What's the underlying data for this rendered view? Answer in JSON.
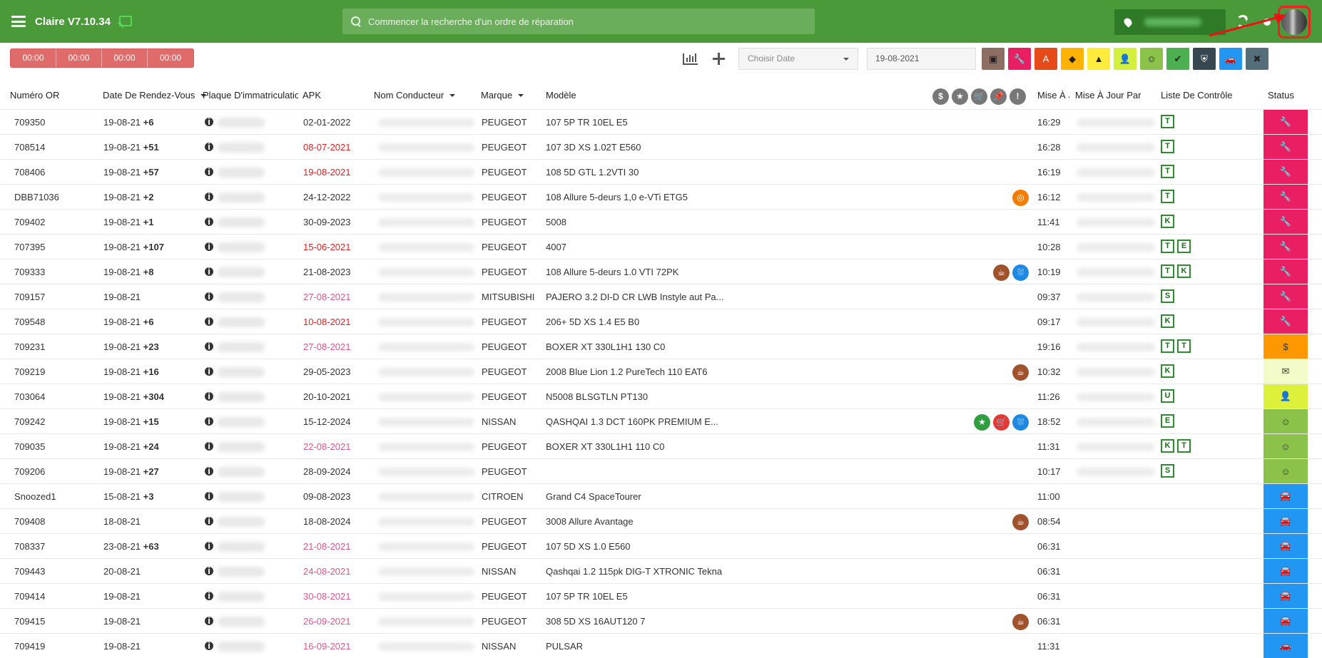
{
  "topbar": {
    "title": "Claire V7.10.34",
    "search_placeholder": "Commencer la recherche d'un ordre de réparation"
  },
  "toolbar": {
    "timers": [
      "00:00",
      "00:00",
      "00:00",
      "00:00"
    ],
    "date_select": "Choisir Date",
    "date_value": "19-08-2021",
    "filters": [
      {
        "name": "calendar-filter-button",
        "icon": "▣",
        "bg": "#8d6e63",
        "fg": "#222"
      },
      {
        "name": "wrench-filter-button",
        "icon": "🔧",
        "bg": "#e91e63",
        "fg": "#222"
      },
      {
        "name": "letter-a-filter-button",
        "icon": "A",
        "bg": "#e64a19",
        "fg": "#fff"
      },
      {
        "name": "tag-filter-button",
        "icon": "◆",
        "bg": "#ffb300",
        "fg": "#222"
      },
      {
        "name": "warning-filter-button",
        "icon": "▲",
        "bg": "#ffeb3b",
        "fg": "#222"
      },
      {
        "name": "user-check-filter-button",
        "icon": "👤",
        "bg": "#d4ef3c",
        "fg": "#222"
      },
      {
        "name": "smiley-filter-button",
        "icon": "☺",
        "bg": "#8bc34a",
        "fg": "#222"
      },
      {
        "name": "double-check-filter-button",
        "icon": "✔",
        "bg": "#4caf50",
        "fg": "#222"
      },
      {
        "name": "shield-filter-button",
        "icon": "⛨",
        "bg": "#37474f",
        "fg": "#fff"
      },
      {
        "name": "car-filter-button",
        "icon": "🚗",
        "bg": "#2196f3",
        "fg": "#222"
      },
      {
        "name": "cancel-filter-button",
        "icon": "✖",
        "bg": "#546e7a",
        "fg": "#222"
      }
    ]
  },
  "table": {
    "headers": {
      "or": "Numéro OR",
      "date": "Date De Rendez-Vous",
      "plate": "Plaque D'immatriculation",
      "apk": "APK",
      "driver": "Nom Conducteur",
      "brand": "Marque",
      "model": "Modèle",
      "updated": "Mise À Jour",
      "updated_by": "Mise À Jour Par",
      "checklist": "Liste De Contrôle",
      "status": "Status"
    },
    "header_icons": [
      "$",
      "★",
      "🛒",
      "📌",
      "!"
    ],
    "rows": [
      {
        "or": "709350",
        "date": "19-08-21",
        "delta": "+6",
        "apk": "02-01-2022",
        "apk_color": "",
        "brand": "PEUGEOT",
        "model": "107 5P TR 10EL E5",
        "time": "16:29",
        "checks": [
          "T"
        ],
        "status_icon": "🔧",
        "status_bg": "#e91e63",
        "icons": []
      },
      {
        "or": "708514",
        "date": "19-08-21",
        "delta": "+51",
        "apk": "08-07-2021",
        "apk_color": "red",
        "brand": "PEUGEOT",
        "model": "107 3D XS 1.02T E560",
        "time": "16:28",
        "checks": [
          "T"
        ],
        "status_icon": "🔧",
        "status_bg": "#e91e63",
        "icons": []
      },
      {
        "or": "708406",
        "date": "19-08-21",
        "delta": "+57",
        "apk": "19-08-2021",
        "apk_color": "red",
        "brand": "PEUGEOT",
        "model": "108 5D GTL 1.2VTI 30",
        "time": "16:19",
        "checks": [
          "T"
        ],
        "status_icon": "🔧",
        "status_bg": "#e91e63",
        "icons": []
      },
      {
        "or": "DBB71036",
        "date": "19-08-21",
        "delta": "+2",
        "apk": "24-12-2022",
        "apk_color": "",
        "brand": "PEUGEOT",
        "model": "108 Allure 5-deurs 1,0 e-VTi ETG5",
        "time": "16:12",
        "checks": [
          "T"
        ],
        "status_icon": "🔧",
        "status_bg": "#e91e63",
        "icons": [
          {
            "name": "target-icon",
            "g": "◎",
            "bg": "#f57c00"
          }
        ]
      },
      {
        "or": "709402",
        "date": "19-08-21",
        "delta": "+1",
        "apk": "30-09-2023",
        "apk_color": "",
        "brand": "PEUGEOT",
        "model": "5008",
        "time": "11:41",
        "checks": [
          "K"
        ],
        "status_icon": "🔧",
        "status_bg": "#e91e63",
        "icons": []
      },
      {
        "or": "707395",
        "date": "19-08-21",
        "delta": "+107",
        "apk": "15-06-2021",
        "apk_color": "red",
        "brand": "PEUGEOT",
        "model": "4007",
        "time": "10:28",
        "checks": [
          "T",
          "E"
        ],
        "status_icon": "🔧",
        "status_bg": "#e91e63",
        "icons": []
      },
      {
        "or": "709333",
        "date": "19-08-21",
        "delta": "+8",
        "apk": "21-08-2023",
        "apk_color": "",
        "brand": "PEUGEOT",
        "model": "108 Allure 5-deurs 1.0 VTI 72PK",
        "time": "10:19",
        "checks": [
          "T",
          "K"
        ],
        "status_icon": "🔧",
        "status_bg": "#e91e63",
        "icons": [
          {
            "name": "coffee-icon",
            "g": "☕",
            "bg": "#a0522d"
          },
          {
            "name": "car-wash-icon",
            "g": "⛆",
            "bg": "#1e88e5"
          }
        ]
      },
      {
        "or": "709157",
        "date": "19-08-21",
        "delta": "",
        "apk": "27-08-2021",
        "apk_color": "pink",
        "brand": "MITSUBISHI",
        "model": "PAJERO 3.2 DI-D CR LWB Instyle aut Pa...",
        "time": "09:37",
        "checks": [
          "S"
        ],
        "status_icon": "🔧",
        "status_bg": "#e91e63",
        "icons": []
      },
      {
        "or": "709548",
        "date": "19-08-21",
        "delta": "+6",
        "apk": "10-08-2021",
        "apk_color": "red",
        "brand": "PEUGEOT",
        "model": "206+ 5D XS 1.4 E5 B0",
        "time": "09:17",
        "checks": [
          "K"
        ],
        "status_icon": "🔧",
        "status_bg": "#e91e63",
        "icons": []
      },
      {
        "or": "709231",
        "date": "19-08-21",
        "delta": "+23",
        "apk": "27-08-2021",
        "apk_color": "pink",
        "brand": "PEUGEOT",
        "model": "BOXER XT 330L1H1 130 C0",
        "time": "19:16",
        "checks": [
          "T",
          "T"
        ],
        "status_icon": "$",
        "status_bg": "#ff9800",
        "icons": []
      },
      {
        "or": "709219",
        "date": "19-08-21",
        "delta": "+16",
        "apk": "29-05-2023",
        "apk_color": "",
        "brand": "PEUGEOT",
        "model": "2008 Blue Lion 1.2 PureTech 110 EAT6",
        "time": "10:32",
        "checks": [
          "K"
        ],
        "status_icon": "✉",
        "status_bg": "#f3fcc8",
        "icons": [
          {
            "name": "coffee-icon",
            "g": "☕",
            "bg": "#a0522d"
          }
        ]
      },
      {
        "or": "703064",
        "date": "19-08-21",
        "delta": "+304",
        "apk": "20-10-2021",
        "apk_color": "",
        "brand": "PEUGEOT",
        "model": "N5008 BLSGTLN PT130",
        "time": "11:26",
        "checks": [
          "U"
        ],
        "status_icon": "👤",
        "status_bg": "#ddf03a",
        "icons": []
      },
      {
        "or": "709242",
        "date": "19-08-21",
        "delta": "+15",
        "apk": "15-12-2024",
        "apk_color": "",
        "brand": "NISSAN",
        "model": "QASHQAI 1.3 DCT 160PK PREMIUM E...",
        "time": "18:52",
        "checks": [
          "E"
        ],
        "status_icon": "☺",
        "status_bg": "#8bc34a",
        "icons": [
          {
            "name": "star-icon",
            "g": "★",
            "bg": "#2e9e3e"
          },
          {
            "name": "cart-icon",
            "g": "🛒",
            "bg": "#e53935"
          },
          {
            "name": "car-wash-icon",
            "g": "⛆",
            "bg": "#1e88e5"
          }
        ]
      },
      {
        "or": "709035",
        "date": "19-08-21",
        "delta": "+24",
        "apk": "22-08-2021",
        "apk_color": "pink",
        "brand": "PEUGEOT",
        "model": "BOXER XT 330L1H1 110 C0",
        "time": "11:31",
        "checks": [
          "K",
          "T"
        ],
        "status_icon": "☺",
        "status_bg": "#8bc34a",
        "icons": []
      },
      {
        "or": "709206",
        "date": "19-08-21",
        "delta": "+27",
        "apk": "28-09-2024",
        "apk_color": "",
        "brand": "PEUGEOT",
        "model": "",
        "time": "10:17",
        "checks": [
          "S"
        ],
        "status_icon": "☺",
        "status_bg": "#8bc34a",
        "icons": []
      },
      {
        "or": "Snoozed1",
        "date": "15-08-21",
        "delta": "+3",
        "apk": "09-08-2023",
        "apk_color": "",
        "brand": "CITROEN",
        "model": "Grand C4 SpaceTourer",
        "time": "11:00",
        "checks": [],
        "status_icon": "🚘",
        "status_bg": "#2196f3",
        "icons": []
      },
      {
        "or": "709408",
        "date": "18-08-21",
        "delta": "",
        "apk": "18-08-2024",
        "apk_color": "",
        "brand": "PEUGEOT",
        "model": "3008 Allure Avantage",
        "time": "08:54",
        "checks": [],
        "status_icon": "🚘",
        "status_bg": "#2196f3",
        "icons": [
          {
            "name": "coffee-icon",
            "g": "☕",
            "bg": "#a0522d"
          }
        ]
      },
      {
        "or": "708337",
        "date": "23-08-21",
        "delta": "+63",
        "apk": "21-08-2021",
        "apk_color": "pink",
        "brand": "PEUGEOT",
        "model": "107 5D XS 1.0 E560",
        "time": "06:31",
        "checks": [],
        "status_icon": "🚘",
        "status_bg": "#2196f3",
        "icons": []
      },
      {
        "or": "709443",
        "date": "20-08-21",
        "delta": "",
        "apk": "24-08-2021",
        "apk_color": "pink",
        "brand": "NISSAN",
        "model": "Qashqai 1.2 115pk DIG-T XTRONIC Tekna",
        "time": "06:31",
        "checks": [],
        "status_icon": "🚘",
        "status_bg": "#2196f3",
        "icons": []
      },
      {
        "or": "709414",
        "date": "19-08-21",
        "delta": "",
        "apk": "30-08-2021",
        "apk_color": "pink",
        "brand": "PEUGEOT",
        "model": "107 5P TR 10EL E5",
        "time": "06:31",
        "checks": [],
        "status_icon": "🚘",
        "status_bg": "#2196f3",
        "icons": []
      },
      {
        "or": "709415",
        "date": "19-08-21",
        "delta": "",
        "apk": "26-09-2021",
        "apk_color": "pink",
        "brand": "PEUGEOT",
        "model": "308 5D XS 16AUT120 7",
        "time": "06:31",
        "checks": [],
        "status_icon": "🚘",
        "status_bg": "#2196f3",
        "icons": [
          {
            "name": "coffee-icon",
            "g": "☕",
            "bg": "#a0522d"
          }
        ]
      },
      {
        "or": "709419",
        "date": "19-08-21",
        "delta": "",
        "apk": "16-09-2021",
        "apk_color": "pink",
        "brand": "NISSAN",
        "model": "PULSAR",
        "time": "11:31",
        "checks": [],
        "status_icon": "🚗",
        "status_bg": "#2196f3",
        "icons": []
      }
    ]
  }
}
